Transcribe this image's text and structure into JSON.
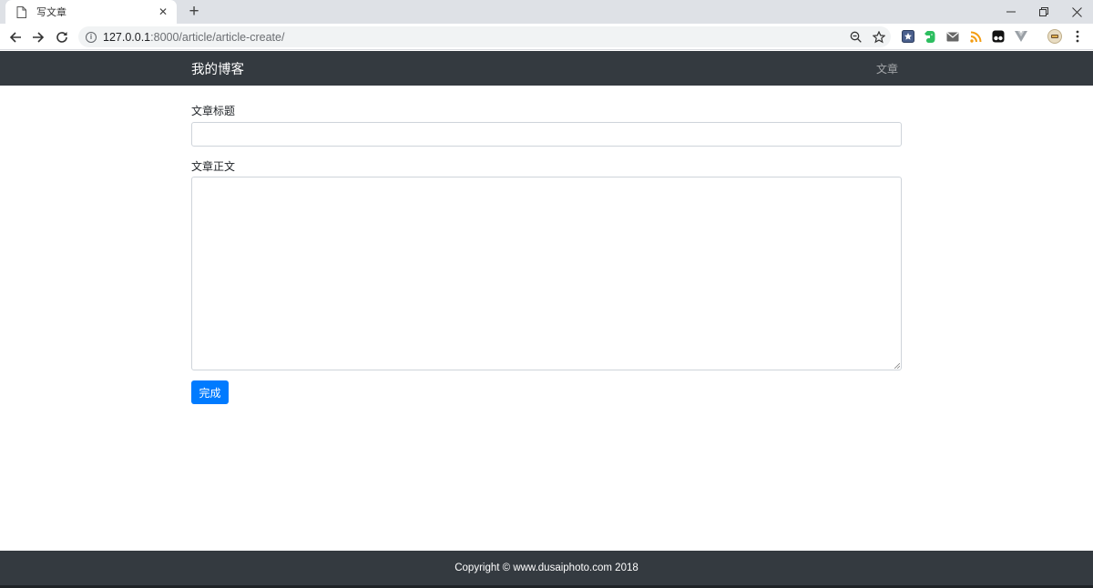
{
  "browser": {
    "tab_title": "写文章",
    "tab_close": "✕",
    "new_tab": "+",
    "url_host": "127.0.0.1",
    "url_path": ":8000/article/article-create/",
    "window_controls": {
      "minimize": "–",
      "restore": "❐",
      "close": "✕"
    }
  },
  "navbar": {
    "brand": "我的博客",
    "link": "文章"
  },
  "form": {
    "title_label": "文章标题",
    "title_value": "",
    "body_label": "文章正文",
    "body_value": "",
    "submit_label": "完成"
  },
  "footer": {
    "copyright": "Copyright © www.dusaiphoto.com 2018"
  },
  "colors": {
    "navbar_bg": "#343a40",
    "primary_button": "#007bff"
  },
  "icons": [
    "page-icon",
    "back-arrow-icon",
    "forward-arrow-icon",
    "reload-icon",
    "info-icon",
    "zoom-icon",
    "star-icon",
    "extension-icons",
    "menu-dots-icon"
  ]
}
